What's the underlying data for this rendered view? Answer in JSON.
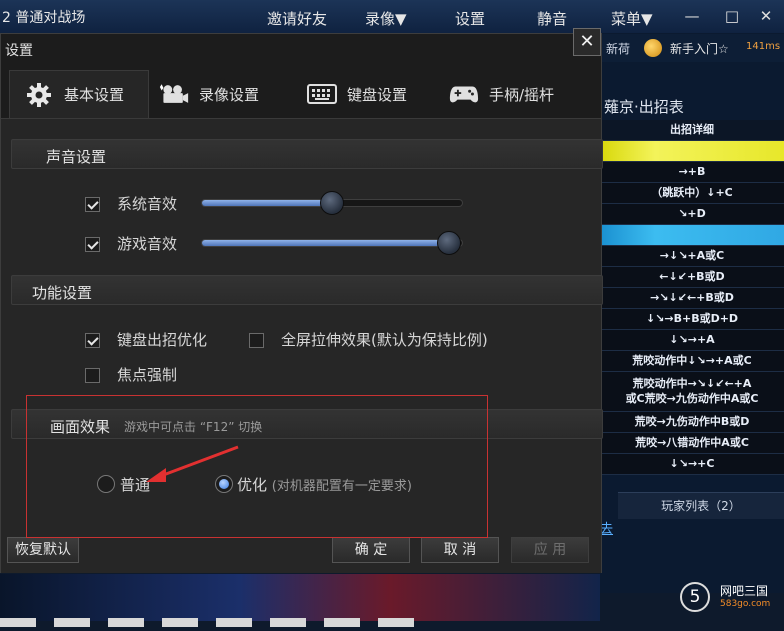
{
  "app": {
    "title": "2 普通对战场",
    "menu": [
      "邀请好友",
      "录像▼",
      "设置",
      "静音",
      "菜单▼"
    ],
    "win_controls": [
      "—",
      "□",
      "✕"
    ]
  },
  "friends": {
    "label": "新荷",
    "coin_label": "新手入门☆",
    "ping": "141ms"
  },
  "moves": {
    "title": "薙京·出招表",
    "header": "出招详细",
    "rows": [
      "",
      "→+B",
      "（跳跃中）↓+C",
      "↘+D",
      "",
      "→↓↘+A或C",
      "←↓↙+B或D",
      "→↘↓↙←+B或D",
      "↓↘→B+B或D+D",
      "↓↘→+A",
      "荒咬动作中↓↘→+A或C",
      "荒咬动作中→↘↓↙←+A",
      "或C荒咬→九伤动作中A或C",
      "荒咬→九伤动作中B或D",
      "荒咬→八错动作中A或C",
      "↓↘→+C"
    ]
  },
  "players_tab": "玩家列表（2）",
  "link": "去",
  "logo": {
    "num": "5",
    "name": "网吧三国",
    "url": "583go.com"
  },
  "dialog": {
    "title": "设置",
    "close": "✕",
    "tabs": [
      {
        "label": "基本设置",
        "icon": "gear-icon",
        "active": true
      },
      {
        "label": "录像设置",
        "icon": "film-camera-icon",
        "active": false
      },
      {
        "label": "键盘设置",
        "icon": "keyboard-icon",
        "active": false
      },
      {
        "label": "手柄/摇杆",
        "icon": "gamepad-icon",
        "active": false
      }
    ],
    "sound": {
      "title": "声音设置",
      "system": {
        "label": "系统音效",
        "checked": true,
        "level_percent": 50
      },
      "game": {
        "label": "游戏音效",
        "checked": true,
        "level_percent": 95
      }
    },
    "function": {
      "title": "功能设置",
      "keyboard_opt": {
        "label": "键盘出招优化",
        "checked": true
      },
      "fullscreen": {
        "label": "全屏拉伸效果(默认为保持比例)",
        "checked": false
      },
      "focus": {
        "label": "焦点强制",
        "checked": false
      }
    },
    "display": {
      "title": "画面效果",
      "hint": "游戏中可点击 “F12” 切换",
      "normal": {
        "label": "普通",
        "selected": false
      },
      "optimized": {
        "label": "优化",
        "note": "(对机器配置有一定要求)",
        "selected": true
      }
    },
    "buttons": {
      "restore": "恢复默认",
      "ok": "确 定",
      "cancel": "取 消",
      "apply": "应 用"
    }
  }
}
